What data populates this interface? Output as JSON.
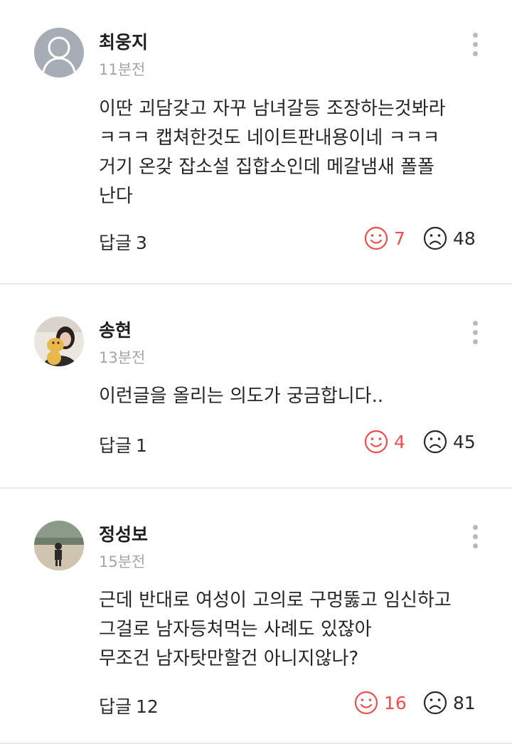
{
  "comments": [
    {
      "author": "최웅지",
      "time": "11분전",
      "avatar_icon": "default-user-silhouette-icon",
      "body": [
        "이딴 괴담갖고 자꾸 남녀갈등 조장하는것봐라",
        "ㅋㅋㅋ 캡쳐한것도 네이트판내용이네 ㅋㅋㅋ",
        "거기 온갖 잡소설 집합소인데 메갈냄새 폴폴",
        "난다"
      ],
      "reply_label": "답글",
      "reply_count": "3",
      "likes": "7",
      "dislikes": "48"
    },
    {
      "author": "송현",
      "time": "13분전",
      "avatar_icon": "profile-photo-icon",
      "body": [
        "이런글을 올리는 의도가 궁금합니다.."
      ],
      "reply_label": "답글",
      "reply_count": "1",
      "likes": "4",
      "dislikes": "45"
    },
    {
      "author": "정성보",
      "time": "15분전",
      "avatar_icon": "profile-photo-icon",
      "body": [
        "근데 반대로 여성이 고의로 구멍뚫고 임신하고",
        "그걸로 남자등쳐먹는 사례도 있잖아",
        "무조건 남자탓만할건 아니지않나?"
      ],
      "reply_label": "답글",
      "reply_count": "12",
      "likes": "16",
      "dislikes": "81"
    }
  ],
  "colors": {
    "like": "#ef4d4d",
    "dislike": "#2a2a2a",
    "timestamp": "#a5a5a5",
    "divider": "#e9e9e9"
  },
  "icons": {
    "like": "smile-face-icon",
    "dislike": "frown-face-icon",
    "more": "more-vertical-icon"
  }
}
